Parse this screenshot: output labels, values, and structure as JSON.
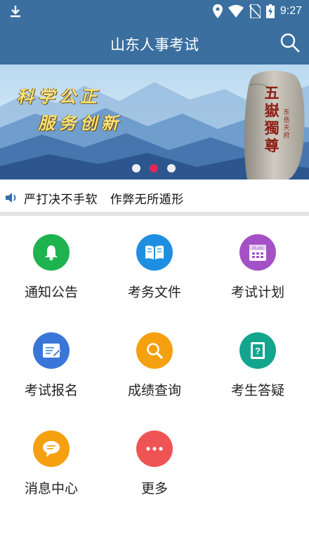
{
  "status_bar": {
    "time": "9:27"
  },
  "app_bar": {
    "title": "山东人事考试"
  },
  "banner": {
    "slogan_line1": "科学公正",
    "slogan_line2": "服务创新",
    "stone_inscription": "五嶽獨尊",
    "stone_small": "东岳天府",
    "slide_count": 3,
    "active_slide": 2
  },
  "notice": {
    "text": "严打决不手软   作弊无所遁形"
  },
  "menu": [
    {
      "label": "通知公告",
      "icon": "bell-icon",
      "color": "#1fb34f"
    },
    {
      "label": "考务文件",
      "icon": "book-icon",
      "color": "#1e8fe0"
    },
    {
      "label": "考试计划",
      "icon": "calendar-plan-icon",
      "color": "#a451c7"
    },
    {
      "label": "考试报名",
      "icon": "register-form-icon",
      "color": "#3a76d8"
    },
    {
      "label": "成绩查询",
      "icon": "magnifier-icon",
      "color": "#f5a00e"
    },
    {
      "label": "考生答疑",
      "icon": "question-note-icon",
      "color": "#13a58e"
    },
    {
      "label": "消息中心",
      "icon": "chat-bubble-icon",
      "color": "#f5a00e"
    },
    {
      "label": "更多",
      "icon": "more-dots-icon",
      "color": "#ef5454"
    }
  ]
}
